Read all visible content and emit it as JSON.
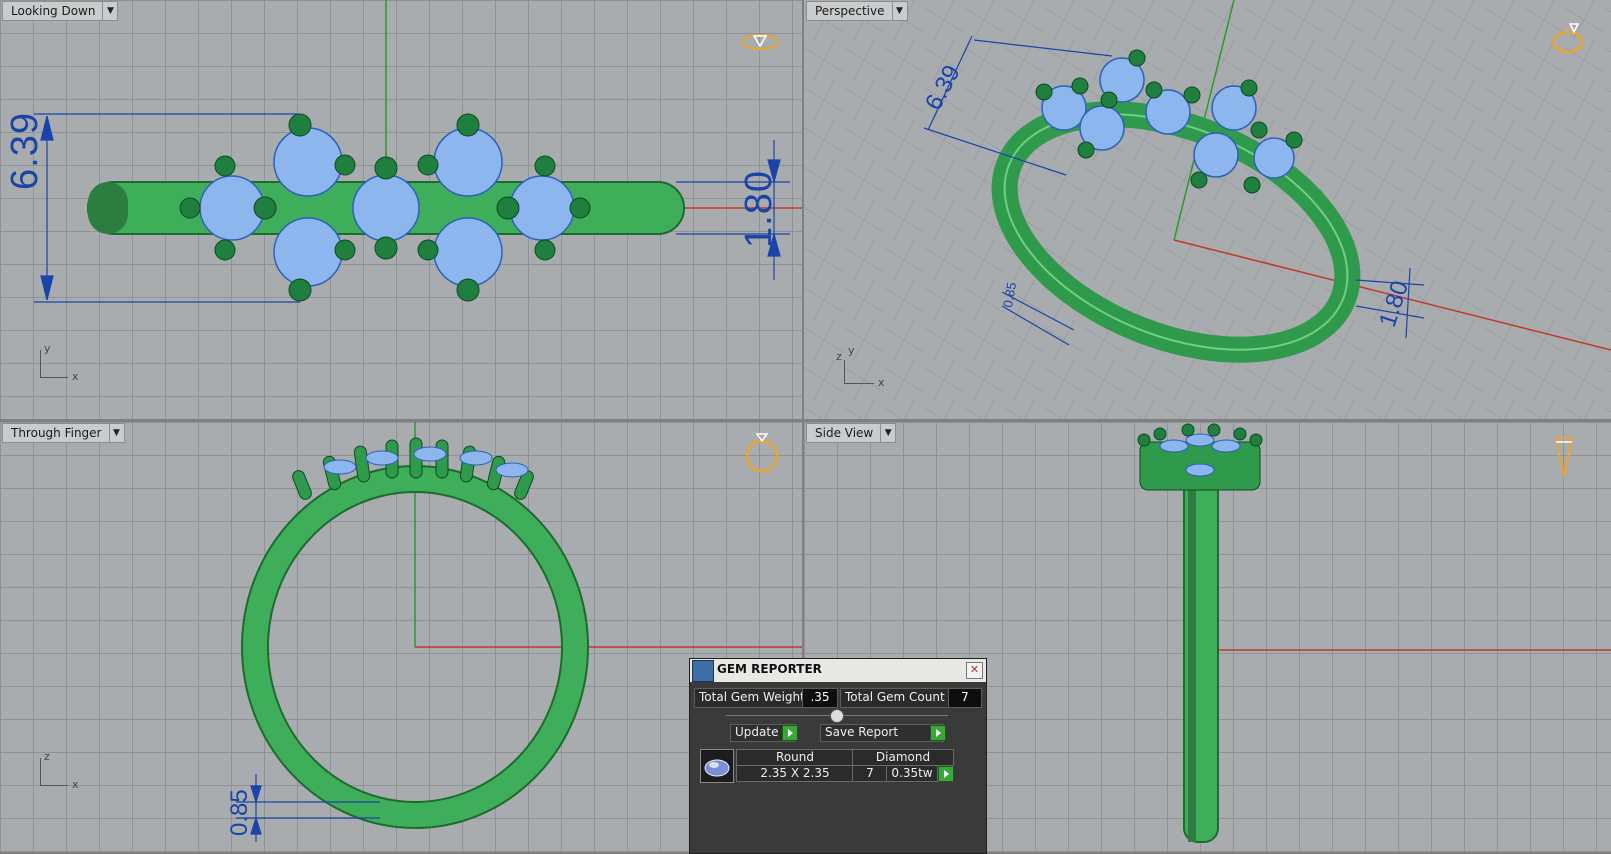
{
  "viewports": {
    "top": {
      "title": "Looking Down",
      "dim_width": "6.39",
      "dim_height": "1.80",
      "axis_x": "x",
      "axis_y": "y"
    },
    "perspective": {
      "title": "Perspective",
      "dim_width": "6.39",
      "dim_height": "1.80",
      "dim_thickness": "0.85",
      "axis_x": "x",
      "axis_y": "y",
      "axis_z": "z"
    },
    "front": {
      "title": "Through Finger",
      "dim_thickness": "0.85",
      "axis_x": "x",
      "axis_z": "z"
    },
    "side": {
      "title": "Side View"
    }
  },
  "gem_reporter": {
    "title": "GEM REPORTER",
    "total_weight_label": "Total Gem Weight",
    "total_weight_value": ".35",
    "total_count_label": "Total Gem Count",
    "total_count_value": "7",
    "update_label": "Update",
    "save_label": "Save Report",
    "row": {
      "shape": "Round",
      "material": "Diamond",
      "size": "2.35 X 2.35",
      "count": "7",
      "weight": "0.35tw"
    }
  },
  "icons": [
    "dropdown-arrow-icon",
    "diamond-view-icon",
    "ring-view-icon",
    "gem-icon",
    "close-icon",
    "play-icon"
  ],
  "colors": {
    "viewport_bg": "#a9acae",
    "grid": "#8f9296",
    "ring_green": "#3fae5a",
    "gem_blue": "#8db5ee",
    "dimension_blue": "#1b44a8",
    "x_axis": "#c0392b",
    "y_axis": "#2a9a2a"
  }
}
